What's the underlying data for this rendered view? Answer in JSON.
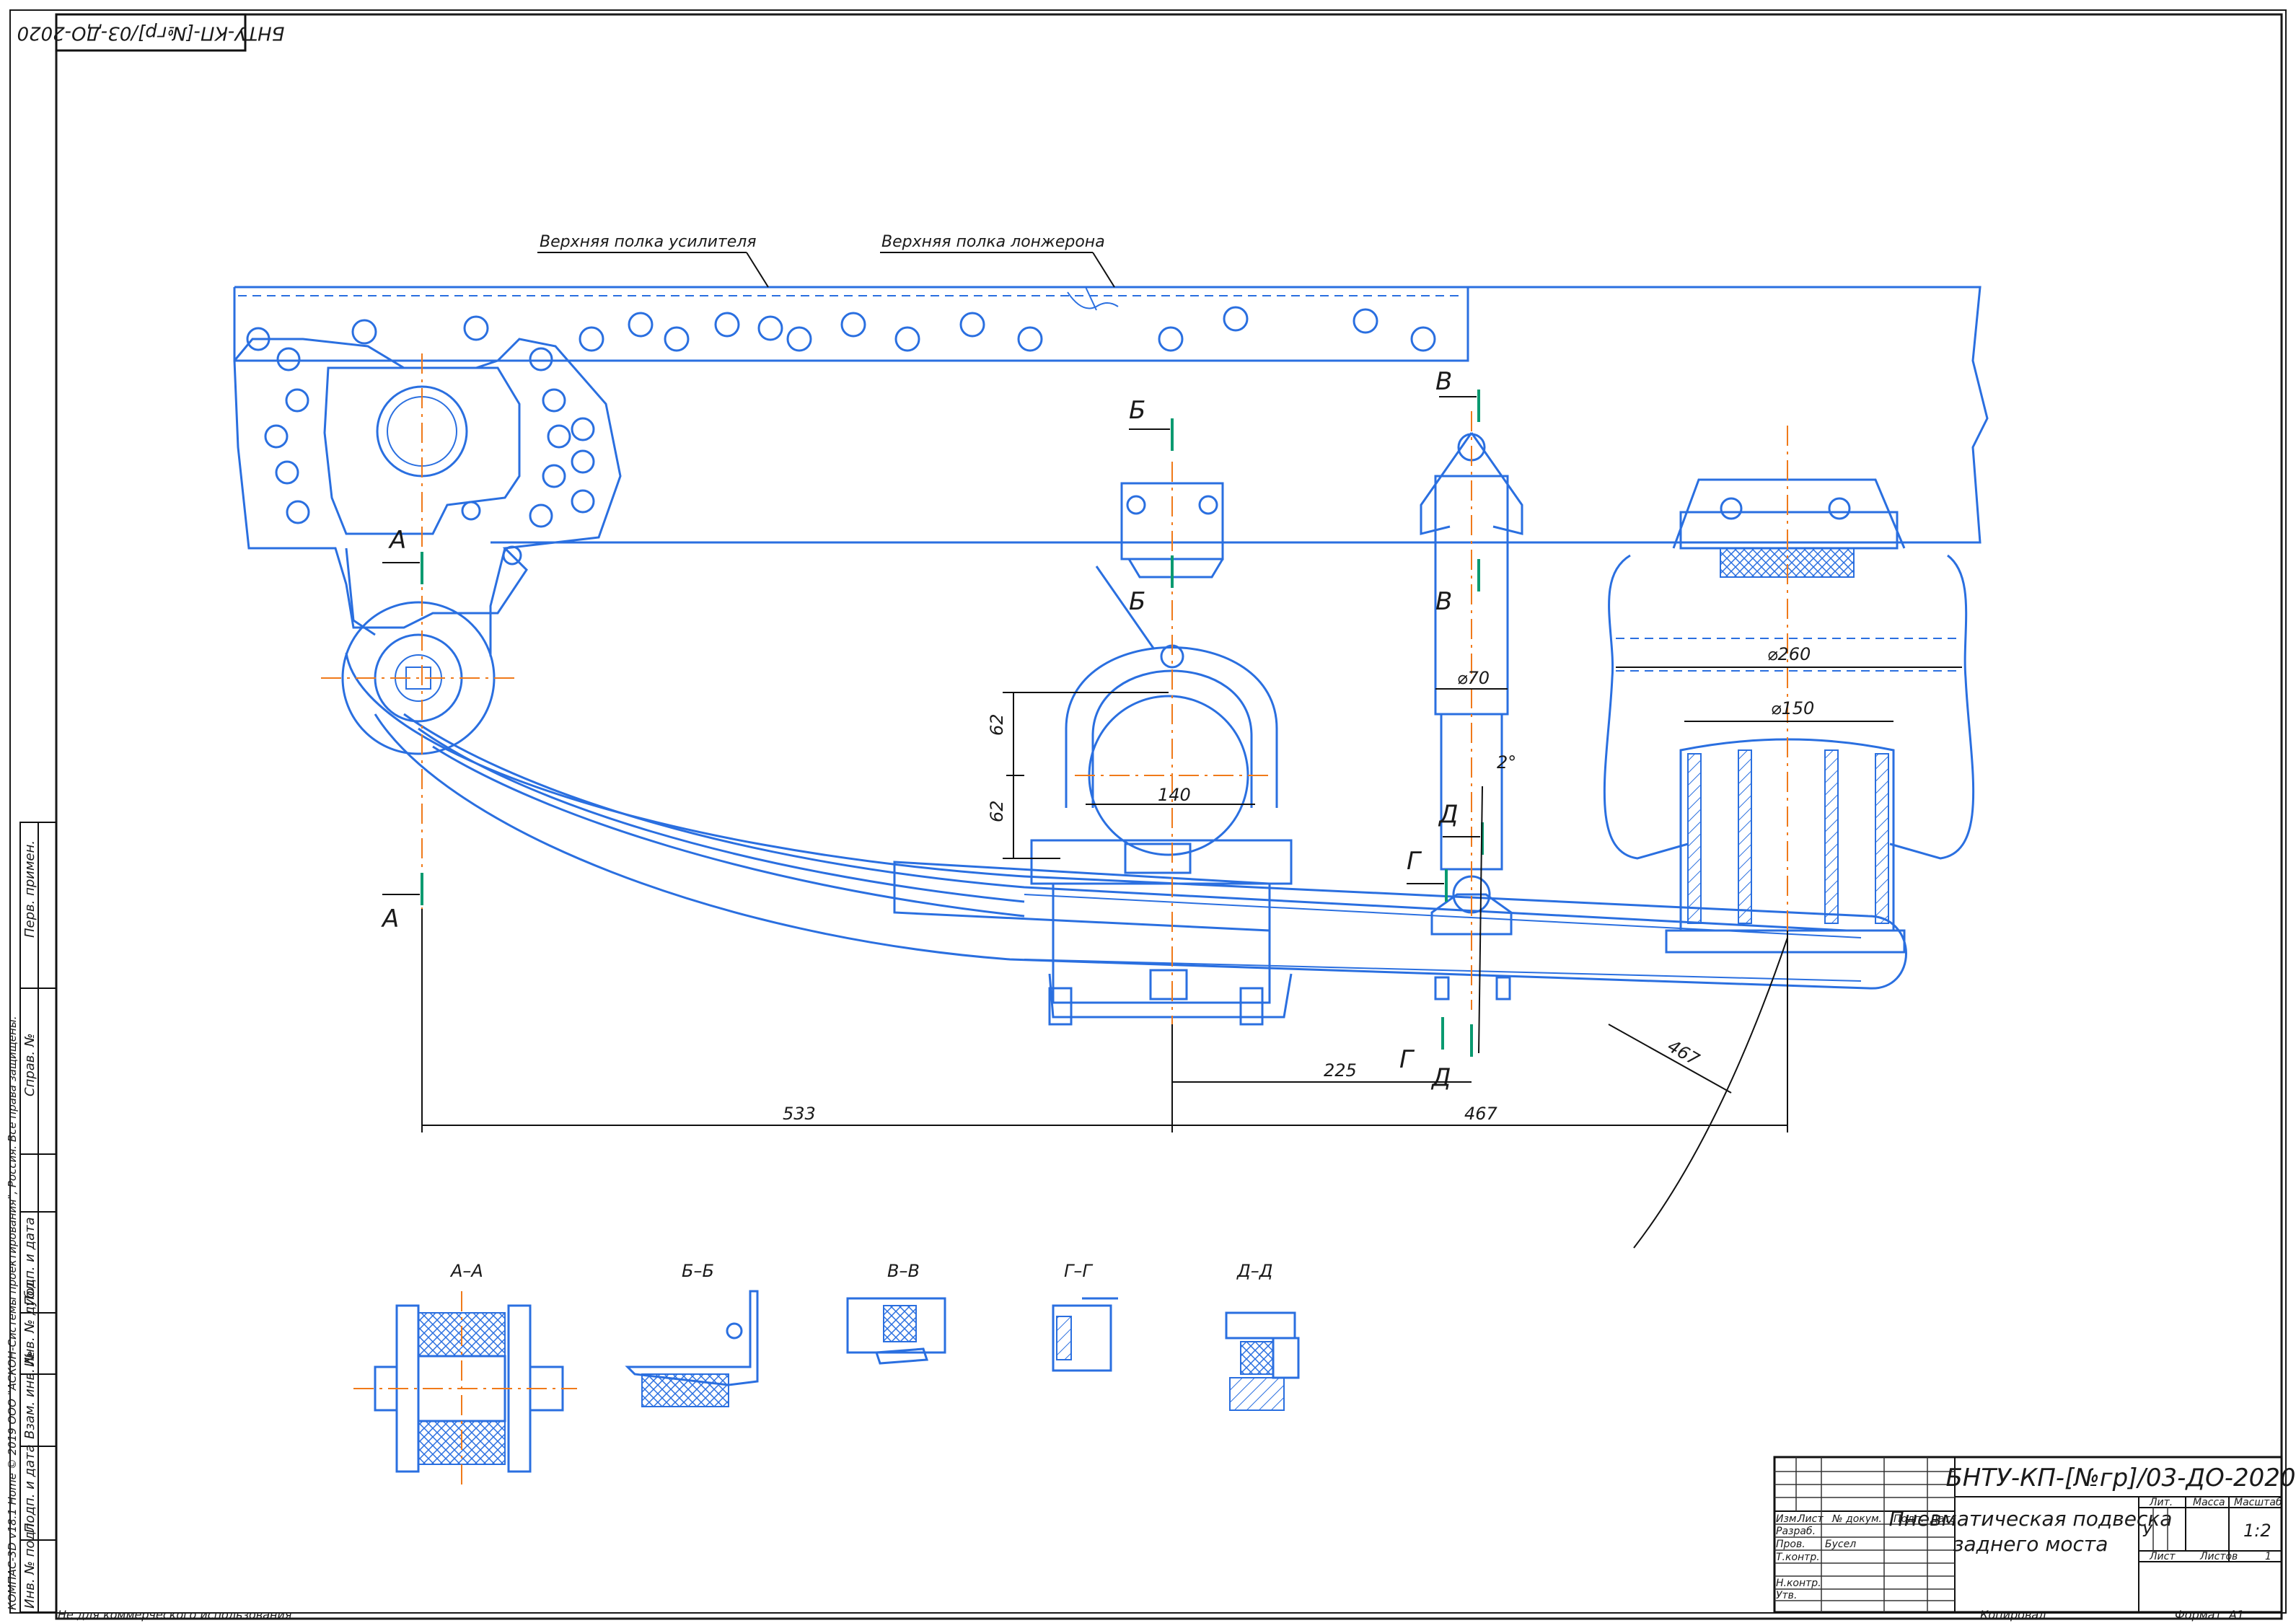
{
  "stamp_rotated": "БНТУ-КП-[№гр]/03-ДО-2020",
  "labels": {
    "reinforcement_flange": "Верхняя полка усилителя",
    "side_member_flange": "Верхняя полка лонжерона"
  },
  "section_marks": {
    "a": "А",
    "b": "Б",
    "v": "В",
    "g": "Г",
    "d": "Д"
  },
  "dimensions": {
    "d260": "⌀260",
    "d150": "⌀150",
    "d70": "⌀70",
    "h62_top": "62",
    "h62_bot": "62",
    "w140": "140",
    "l225": "225",
    "l533": "533",
    "l467": "467",
    "r467": "467",
    "angle": "2°"
  },
  "sections": {
    "aa": "А–А",
    "bb": "Б–Б",
    "vv": "В–В",
    "gg": "Г–Г",
    "dd": "Д–Д"
  },
  "side_stamp": {
    "perv_primen": "Перв. примен.",
    "sprav": "Справ. №",
    "podp_data1": "Подп. и дата",
    "inv_dubl": "Инв. № дубл.",
    "vzam_inv": "Взам. инв. №",
    "podp_data2": "Подп. и дата",
    "inv_podl": "Инв. № подл.",
    "kompas": "КОМПАС-3D v18.1 Home © 2019 ООО \"АСКОН-Системы проектирования\", Россия. Все права защищены."
  },
  "footer": {
    "noncommercial": "Не для коммерческого использования",
    "kopiroval": "Копировал",
    "format_label": "Формат",
    "format_value": "А1"
  },
  "title_block": {
    "code": "БНТУ-КП-[№гр]/03-ДО-2020",
    "name_line1": "Пневматическая подвеска",
    "name_line2": "заднего моста",
    "col_izm": "Изм.",
    "col_list": "Лист",
    "col_ndoc": "№ докум.",
    "col_podp": "Подп.",
    "col_data": "Дата",
    "row_razrab": "Разраб.",
    "row_prov": "Пров.",
    "row_tkontr": "Т.контр.",
    "row_nkontr": "Н.контр.",
    "row_utv": "Утв.",
    "prov_name": "Бусел",
    "lit": "Лит.",
    "massa": "Масса",
    "masshtab": "Масштаб",
    "lit_value": "У",
    "masshtab_value": "1:2",
    "list": "Лист",
    "listov": "Листов",
    "listov_value": "1"
  }
}
